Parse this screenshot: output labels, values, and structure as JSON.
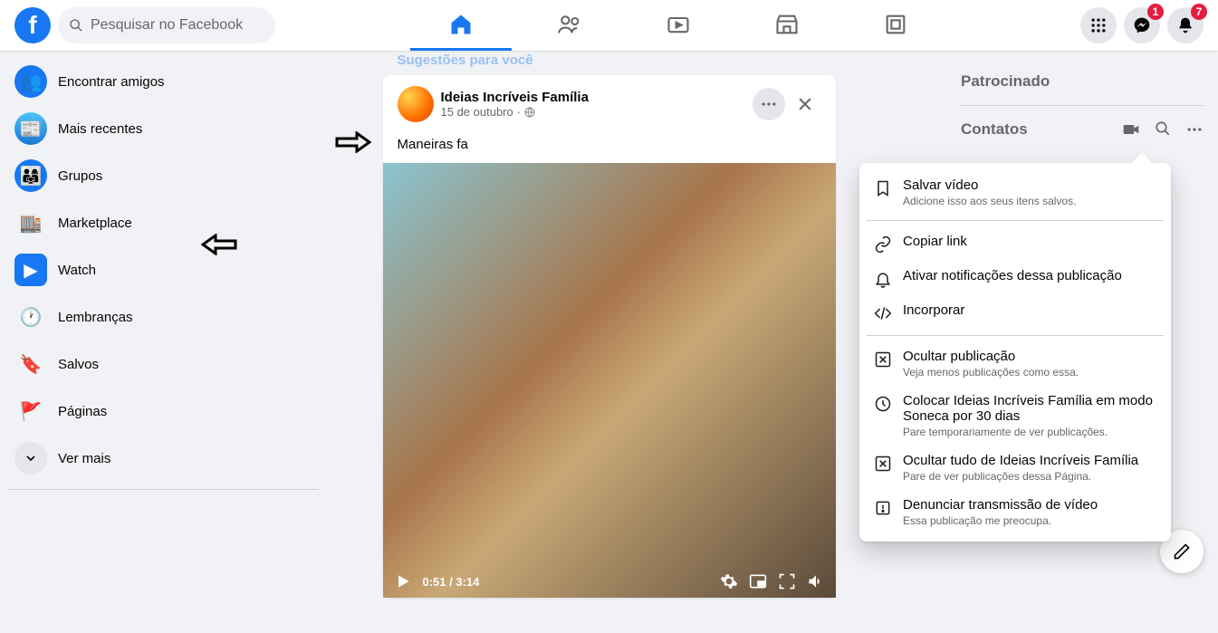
{
  "header": {
    "search_placeholder": "Pesquisar no Facebook",
    "messenger_badge": "1",
    "notifications_badge": "7"
  },
  "sidebar": {
    "items": [
      {
        "label": "Encontrar amigos",
        "icon": "friends"
      },
      {
        "label": "Mais recentes",
        "icon": "recent"
      },
      {
        "label": "Grupos",
        "icon": "groups"
      },
      {
        "label": "Marketplace",
        "icon": "marketplace"
      },
      {
        "label": "Watch",
        "icon": "watch"
      },
      {
        "label": "Lembranças",
        "icon": "memories"
      },
      {
        "label": "Salvos",
        "icon": "saved"
      },
      {
        "label": "Páginas",
        "icon": "pages"
      },
      {
        "label": "Ver mais",
        "icon": "more"
      }
    ]
  },
  "feed": {
    "suggestions_label": "Sugestões para você",
    "post": {
      "author": "Ideias Incríveis Família",
      "time": "15 de outubro",
      "text_prefix": "Maneiras fa",
      "video": {
        "current": "0:51",
        "total": "3:14"
      }
    }
  },
  "dropdown": {
    "items": [
      {
        "title": "Salvar vídeo",
        "sub": "Adicione isso aos seus itens salvos.",
        "icon": "bookmark"
      },
      {
        "title": "Copiar link",
        "sub": "",
        "icon": "link"
      },
      {
        "title": "Ativar notificações dessa publicação",
        "sub": "",
        "icon": "bell"
      },
      {
        "title": "Incorporar",
        "sub": "",
        "icon": "embed"
      },
      {
        "title": "Ocultar publicação",
        "sub": "Veja menos publicações como essa.",
        "icon": "hide"
      },
      {
        "title": "Colocar Ideias Incríveis Família em modo Soneca por 30 dias",
        "sub": "Pare temporariamente de ver publicações.",
        "icon": "clock"
      },
      {
        "title": "Ocultar tudo de Ideias Incríveis Família",
        "sub": "Pare de ver publicações dessa Página.",
        "icon": "hide"
      },
      {
        "title": "Denunciar transmissão de vídeo",
        "sub": "Essa publicação me preocupa.",
        "icon": "report"
      }
    ]
  },
  "right": {
    "sponsored": "Patrocinado",
    "contacts": "Contatos"
  }
}
